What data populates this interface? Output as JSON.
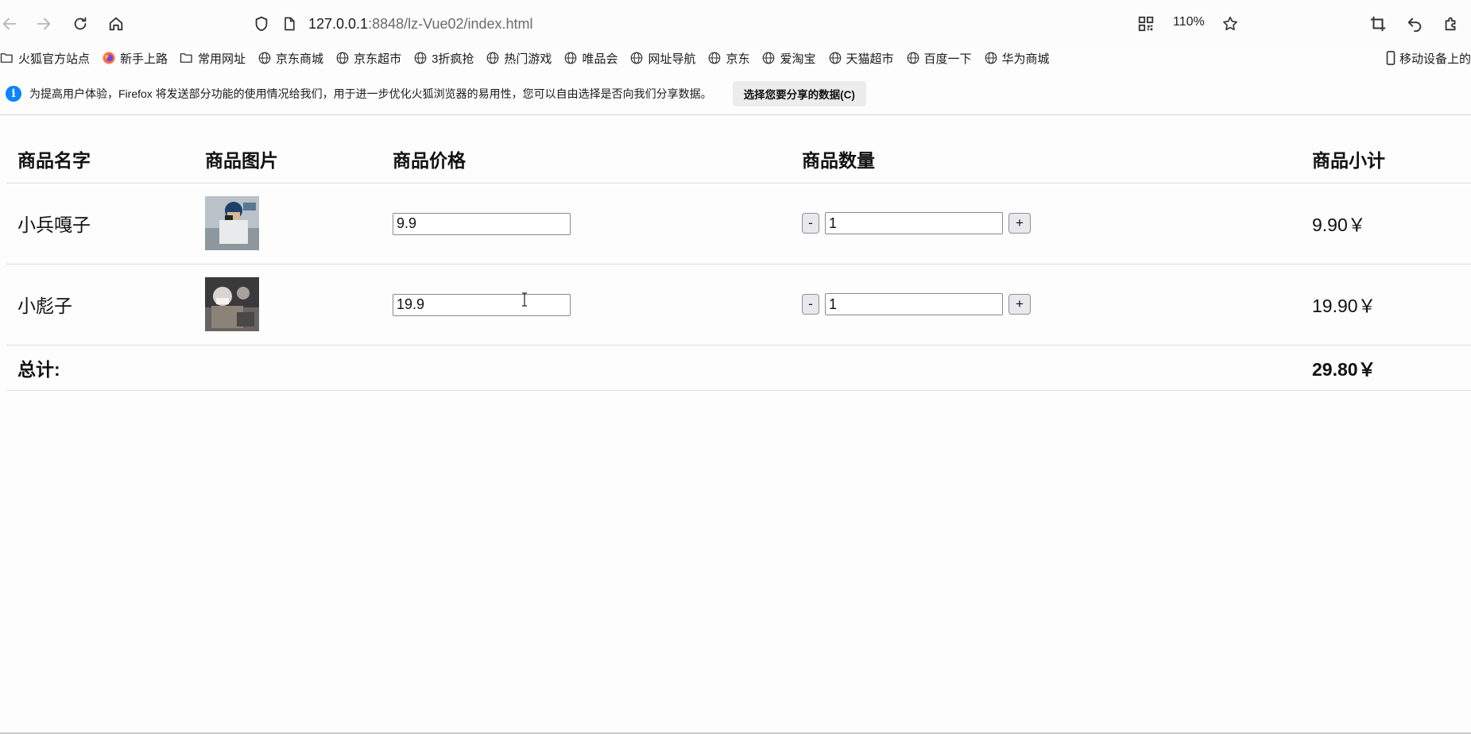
{
  "browser": {
    "url_host": "127.0.0.1",
    "url_rest": ":8848/lz-Vue02/index.html",
    "zoom": "110%",
    "bookmarks": [
      {
        "label": "火狐官方站点",
        "icon": "folder-icon"
      },
      {
        "label": "新手上路",
        "icon": "firefox-icon"
      },
      {
        "label": "常用网址",
        "icon": "folder-icon"
      },
      {
        "label": "京东商城",
        "icon": "globe-icon"
      },
      {
        "label": "京东超市",
        "icon": "globe-icon"
      },
      {
        "label": "3折疯抢",
        "icon": "globe-icon"
      },
      {
        "label": "热门游戏",
        "icon": "globe-icon"
      },
      {
        "label": "唯品会",
        "icon": "globe-icon"
      },
      {
        "label": "网址导航",
        "icon": "globe-icon"
      },
      {
        "label": "京东",
        "icon": "globe-icon"
      },
      {
        "label": "爱淘宝",
        "icon": "globe-icon"
      },
      {
        "label": "天猫超市",
        "icon": "globe-icon"
      },
      {
        "label": "百度一下",
        "icon": "globe-icon"
      },
      {
        "label": "华为商城",
        "icon": "globe-icon"
      }
    ],
    "mobile_bookmarks": "移动设备上的",
    "notification": {
      "text": "为提高用户体验，Firefox 将发送部分功能的使用情况给我们，用于进一步优化火狐浏览器的易用性，您可以自由选择是否向我们分享数据。",
      "button": "选择您要分享的数据(C)"
    }
  },
  "cart": {
    "headers": {
      "name": "商品名字",
      "image": "商品图片",
      "price": "商品价格",
      "quantity": "商品数量",
      "subtotal": "商品小计"
    },
    "items": [
      {
        "name": "小兵嘎子",
        "price": "9.9",
        "quantity": "1",
        "subtotal": "9.90￥"
      },
      {
        "name": "小彪子",
        "price": "19.9",
        "quantity": "1",
        "subtotal": "19.90￥"
      }
    ],
    "minus_label": "-",
    "plus_label": "+",
    "total_label": "总计:",
    "total_value": "29.80￥"
  }
}
